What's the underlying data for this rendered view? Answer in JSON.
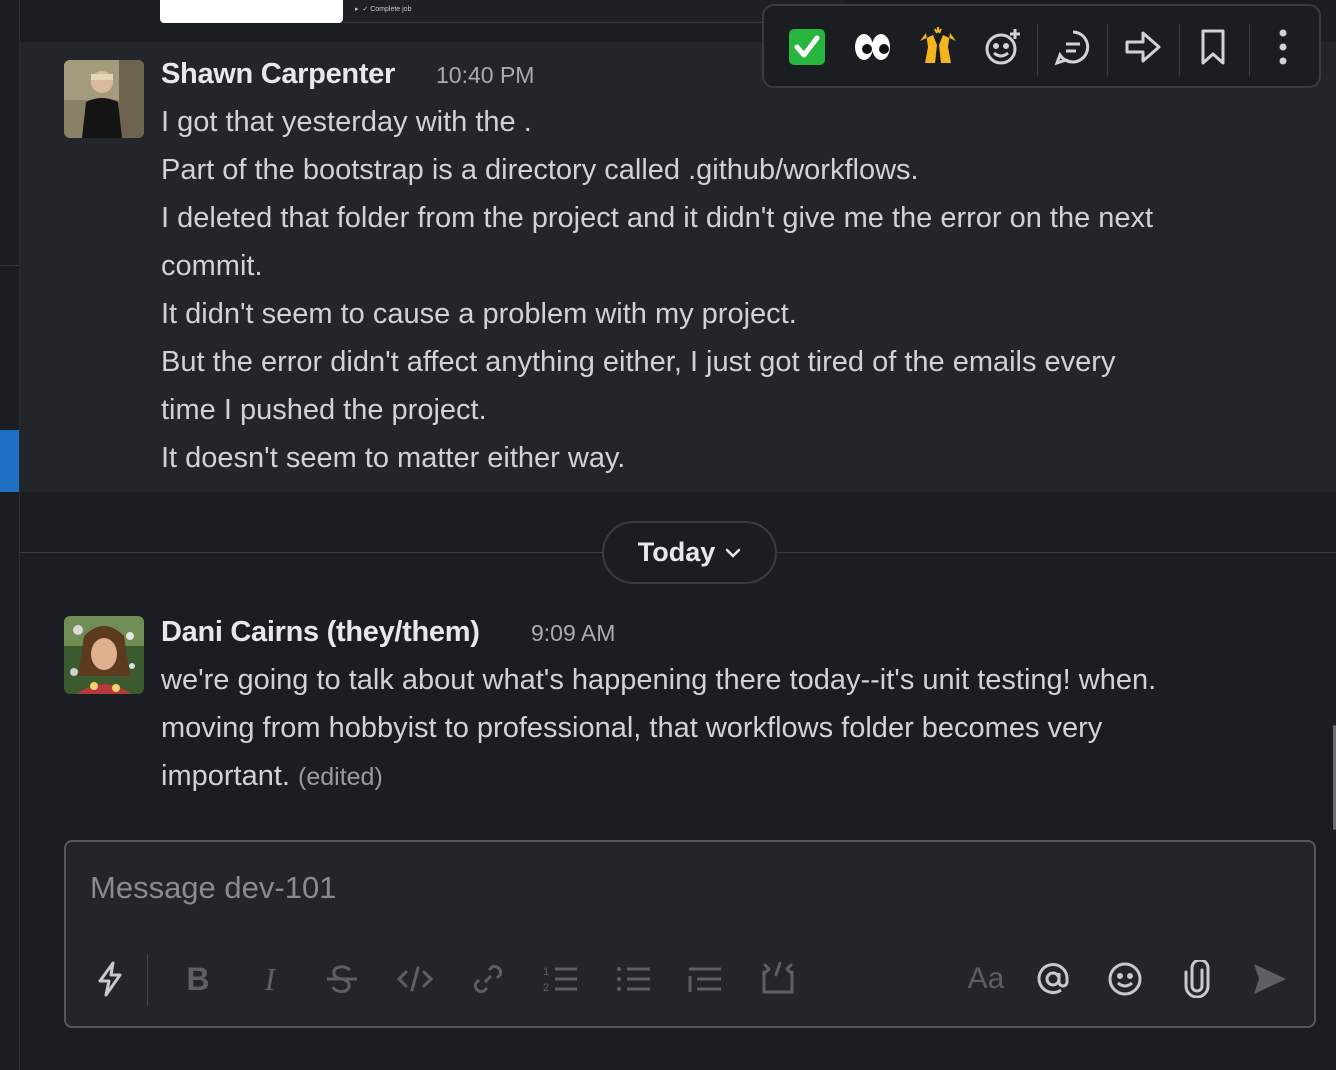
{
  "previous_attachment": {
    "label": "Complete job"
  },
  "hover_toolbar": {
    "reactions": [
      {
        "emoji": "✅",
        "icon": "white-check-mark-icon"
      },
      {
        "emoji": "👀",
        "icon": "eyes-icon"
      },
      {
        "emoji": "🙌",
        "icon": "raised-hands-icon"
      }
    ],
    "actions": [
      "add-reaction-icon",
      "reply-in-thread-icon",
      "forward-icon",
      "bookmark-icon",
      "more-actions-icon"
    ]
  },
  "messages": [
    {
      "sender": "Shawn Carpenter",
      "time": "10:40 PM",
      "lines": [
        "I got that yesterday with the .",
        "Part of the bootstrap is a directory called .github/workflows.",
        "I deleted that folder from the project and it didn't give me the error on the next",
        "commit.",
        "It didn't seem to cause a problem with my project.",
        "But the error didn't affect anything either, I just got tired of the emails every",
        "time I pushed the project.",
        "It doesn't seem to matter either way."
      ]
    },
    {
      "sender": "Dani Cairns (they/them)",
      "time": "9:09 AM",
      "lines": [
        "we're going to talk about what's happening there today--it's unit testing! when.",
        "moving from hobbyist to professional, that workflows folder becomes very",
        "important."
      ],
      "edited_label": "(edited)"
    }
  ],
  "date_divider": {
    "label": "Today"
  },
  "composer": {
    "placeholder": "Message dev-101",
    "format_buttons": {
      "bold": "B",
      "italic": "I",
      "text_format": "Aa"
    }
  },
  "colors": {
    "background": "#1a1d21",
    "hover_background": "#222529",
    "accent": "#1d6fc4",
    "text": "#d1d2d3"
  }
}
